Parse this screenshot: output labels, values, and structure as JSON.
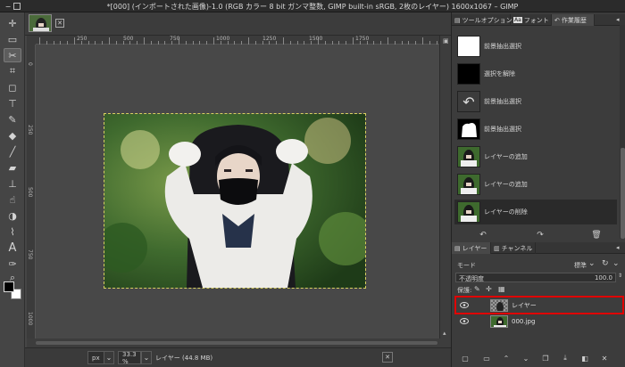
{
  "window": {
    "title": "*[000] (インポートされた画像)-1.0 (RGB カラー 8 bit ガンマ整数, GIMP built-in sRGB, 2枚のレイヤー) 1600x1067 – GIMP",
    "menu_glyph": "−",
    "maximize_glyph": "□"
  },
  "ruler": {
    "h_labels": [
      "250",
      "500",
      "750",
      "1000",
      "1250",
      "1500",
      "1750"
    ],
    "v_labels": [
      "0",
      "250",
      "500",
      "750",
      "1000"
    ]
  },
  "image_tab": {
    "close_glyph": "✕"
  },
  "statusbar": {
    "unit": "px",
    "zoom": "33.3 %",
    "layer_info": "レイヤー (44.8 MB)",
    "cancel_glyph": "✕"
  },
  "dock_top": {
    "tabs": [
      {
        "label": "ツールオプション",
        "icon": "tool-options-icon"
      },
      {
        "label": "フォント",
        "icon": "font-icon"
      },
      {
        "label": "作業履歴",
        "icon": "history-icon"
      }
    ],
    "history": [
      {
        "label": "前景抽出選択",
        "thumb": "white"
      },
      {
        "label": "選択を解除",
        "thumb": "black"
      },
      {
        "label": "前景抽出選択",
        "thumb": "undo"
      },
      {
        "label": "前景抽出選択",
        "thumb": "mask"
      },
      {
        "label": "レイヤーの追加",
        "thumb": "photo"
      },
      {
        "label": "レイヤーの追加",
        "thumb": "photo"
      },
      {
        "label": "レイヤーの削除",
        "thumb": "photo"
      }
    ],
    "buttons": {
      "undo": "↶",
      "redo": "↷",
      "clear": "🗑"
    }
  },
  "dock_bottom": {
    "tabs": [
      {
        "label": "レイヤー",
        "icon": "layers-icon"
      },
      {
        "label": "チャンネル",
        "icon": "channels-icon"
      }
    ],
    "mode_label": "モード",
    "mode_value": "標準",
    "opacity_label": "不透明度",
    "opacity_value": "100.0",
    "lock_label": "保護:",
    "layers": [
      {
        "name": "レイヤー",
        "visible": true,
        "selected": true,
        "thumb": "checker"
      },
      {
        "name": "000.jpg",
        "visible": true,
        "selected": false,
        "thumb": "photo"
      }
    ]
  },
  "colors": {
    "accent_red": "#e00000",
    "selection_dash": "#d8d060"
  }
}
